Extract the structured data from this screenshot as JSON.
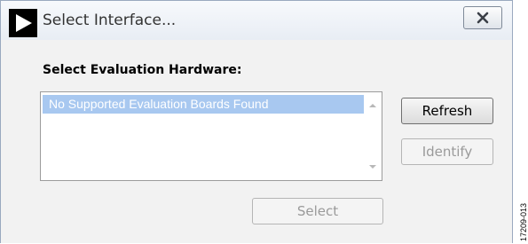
{
  "window": {
    "title": "Select Interface...",
    "icons": {
      "app": "play-arrow-icon",
      "close": "close-x-icon"
    }
  },
  "main": {
    "heading": "Select Evaluation Hardware:",
    "list": {
      "items": [
        "No Supported Evaluation Boards Found"
      ]
    },
    "buttons": {
      "refresh": "Refresh",
      "identify": "Identify",
      "select": "Select"
    }
  },
  "figure_code": "17209-013"
}
